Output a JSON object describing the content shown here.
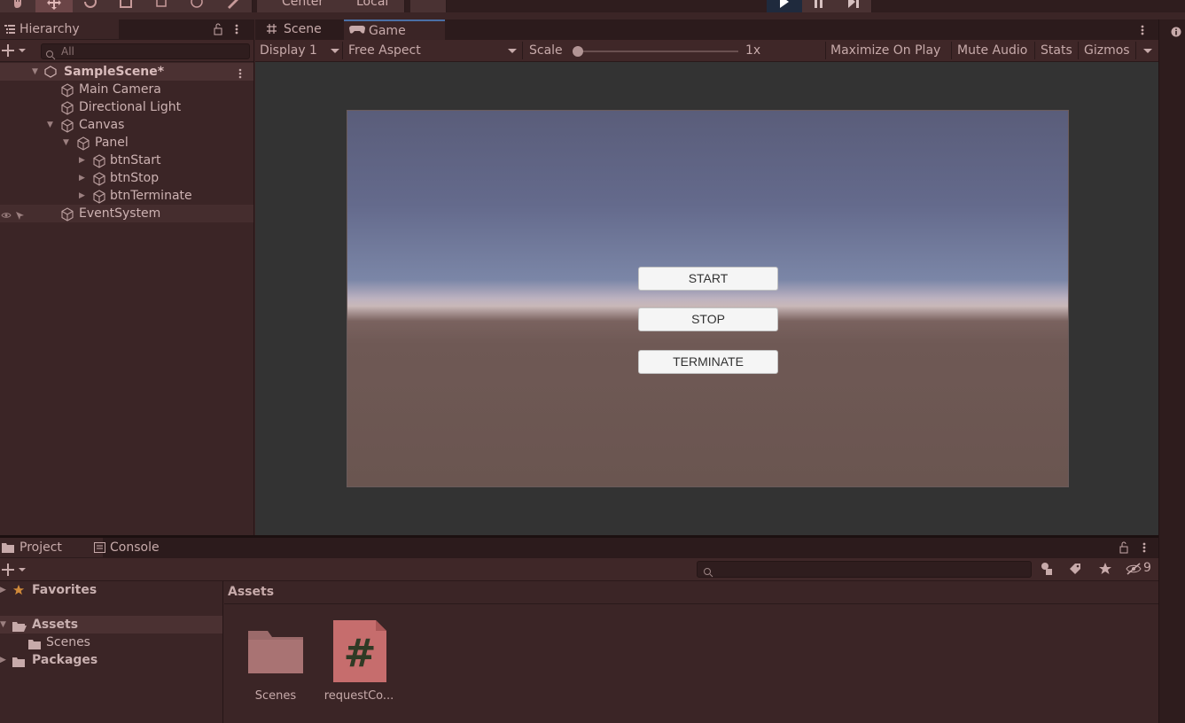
{
  "colors": {
    "accent": "#3b2526",
    "play_active": "#1f2a3d",
    "asset_script": "#c66d6d"
  },
  "toolbar": {
    "pivot_label": "Center",
    "space_label": "Local"
  },
  "hierarchy": {
    "tab_label": "Hierarchy",
    "search_placeholder": "All",
    "scene_name": "SampleScene*",
    "items": [
      {
        "label": "Main Camera"
      },
      {
        "label": "Directional Light"
      },
      {
        "label": "Canvas"
      },
      {
        "label": "Panel"
      },
      {
        "label": "btnStart"
      },
      {
        "label": "btnStop"
      },
      {
        "label": "btnTerminate"
      },
      {
        "label": "EventSystem"
      }
    ]
  },
  "view_tabs": {
    "scene": "Scene",
    "game": "Game"
  },
  "game_bar": {
    "display": "Display 1",
    "aspect": "Free Aspect",
    "scale_label": "Scale",
    "scale_value": "1x",
    "maximize": "Maximize On Play",
    "mute": "Mute Audio",
    "stats": "Stats",
    "gizmos": "Gizmos"
  },
  "game": {
    "buttons": [
      "START",
      "STOP",
      "TERMINATE"
    ]
  },
  "project": {
    "tab_project": "Project",
    "tab_console": "Console",
    "hidden_count": "9",
    "tree": {
      "favorites": "Favorites",
      "assets": "Assets",
      "scenes": "Scenes",
      "packages": "Packages"
    },
    "breadcrumb": "Assets",
    "assets": [
      {
        "name": "Scenes",
        "icon": "folder-icon"
      },
      {
        "name": "requestCo...",
        "icon": "csharp-script-icon"
      }
    ]
  }
}
